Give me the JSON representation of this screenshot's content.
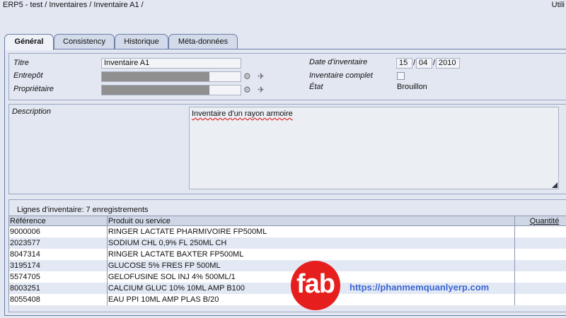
{
  "breadcrumb": "ERP5 - test / Inventaires / Inventaire A1 /",
  "utility_label": "Utili",
  "tabs": [
    {
      "label": "Général",
      "active": true
    },
    {
      "label": "Consistency",
      "active": false
    },
    {
      "label": "Historique",
      "active": false
    },
    {
      "label": "Méta-données",
      "active": false
    }
  ],
  "form": {
    "titre_label": "Titre",
    "titre_value": "Inventaire A1",
    "entrepot_label": "Entrepôt",
    "proprietaire_label": "Propriétaire",
    "date_label": "Date d'inventaire",
    "date_day": "15",
    "date_month": "04",
    "date_year": "2010",
    "complet_label": "Inventaire complet",
    "complet_checked": false,
    "etat_label": "État",
    "etat_value": "Brouillon",
    "description_label": "Description",
    "description_value": "Inventaire d'un rayon armoire"
  },
  "icons": {
    "search": "search-icon",
    "jump": "plane-icon"
  },
  "lines": {
    "caption": "Lignes d'inventaire: 7 enregistrements",
    "columns": [
      "Référence",
      "Produit ou service",
      "Quantité"
    ],
    "rows": [
      {
        "ref": "9000006",
        "product": "RINGER LACTATE PHARMIVOIRE FP500ML",
        "qty": ""
      },
      {
        "ref": "2023577",
        "product": "SODIUM CHL 0,9% FL 250ML CH",
        "qty": ""
      },
      {
        "ref": "8047314",
        "product": "RINGER LACTATE BAXTER FP500ML",
        "qty": ""
      },
      {
        "ref": "3195174",
        "product": "GLUCOSE 5% FRES FP 500ML",
        "qty": ""
      },
      {
        "ref": "5574705",
        "product": "GELOFUSINE SOL INJ 4% 500ML/1",
        "qty": ""
      },
      {
        "ref": "8003251",
        "product": "CALCIUM GLUC 10% 10ML AMP B100",
        "qty": ""
      },
      {
        "ref": "8055408",
        "product": "EAU PPI 10ML AMP PLAS B/20",
        "qty": ""
      }
    ]
  },
  "watermark": {
    "logo_text": "fab",
    "url": "https://phanmemquanlyerp.com"
  },
  "colors": {
    "background": "#e2e7f1",
    "logo_red": "#e61e1e",
    "url_blue": "#3a66d4"
  }
}
